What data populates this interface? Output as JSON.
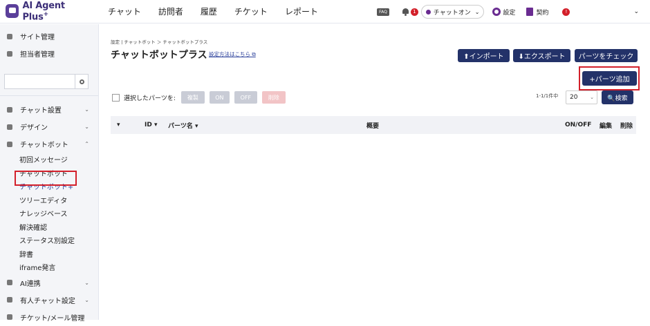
{
  "header": {
    "logo_text": "AI Agent Plus",
    "logo_sup": "+",
    "nav": [
      "チャット",
      "訪問者",
      "履歴",
      "チケット",
      "レポート"
    ],
    "faq": "FAQ",
    "bell_count": "1",
    "chat_status": "チャットオン",
    "settings_label": "設定",
    "contract_label": "契約",
    "alert_count": "!"
  },
  "sidebar": {
    "top_items": [
      "サイト管理",
      "担当者管理"
    ],
    "search_value": "",
    "menu": [
      {
        "label": "チャット設置",
        "chevron": "⌄"
      },
      {
        "label": "デザイン",
        "chevron": "⌄"
      },
      {
        "label": "チャットボット",
        "chevron": "⌃"
      }
    ],
    "sub_items": [
      "初回メッセージ",
      "チャットボット",
      "チャットボット+",
      "ツリーエディタ",
      "ナレッジベース",
      "解決確認",
      "ステータス別設定",
      "辞書",
      "iframe発言"
    ],
    "bottom_items": [
      {
        "label": "AI連携",
        "chevron": "⌄"
      },
      {
        "label": "有人チャット設定",
        "chevron": "⌄"
      },
      {
        "label": "チケット/メール管理",
        "chevron": ""
      }
    ]
  },
  "main": {
    "breadcrumb": "設定 | チャットボット ＞ チャットボットプラス",
    "title": "チャットボットプラス",
    "howto_link": "設定方法はこちら ⧉",
    "import_label": "⬆インポート",
    "export_label": "⬇エクスポート",
    "check_label": "パーツをチェック",
    "add_label": "+パーツ追加",
    "bulk_label": "選択したパーツを:",
    "bulk_buttons": [
      "複製",
      "ON",
      "OFF",
      "削除"
    ],
    "pager": "1-1/1件中",
    "per_page": "20",
    "search_label": "🔍検索",
    "columns": {
      "sort": "▾",
      "id": "ID ▾",
      "name": "パーツ名 ▾",
      "summary": "概要",
      "onoff": "ON/OFF",
      "edit": "編集",
      "delete": "削除"
    }
  },
  "colors": {
    "accent": "#233269",
    "brand": "#5b3f9a",
    "highlight": "#d31f2a"
  }
}
